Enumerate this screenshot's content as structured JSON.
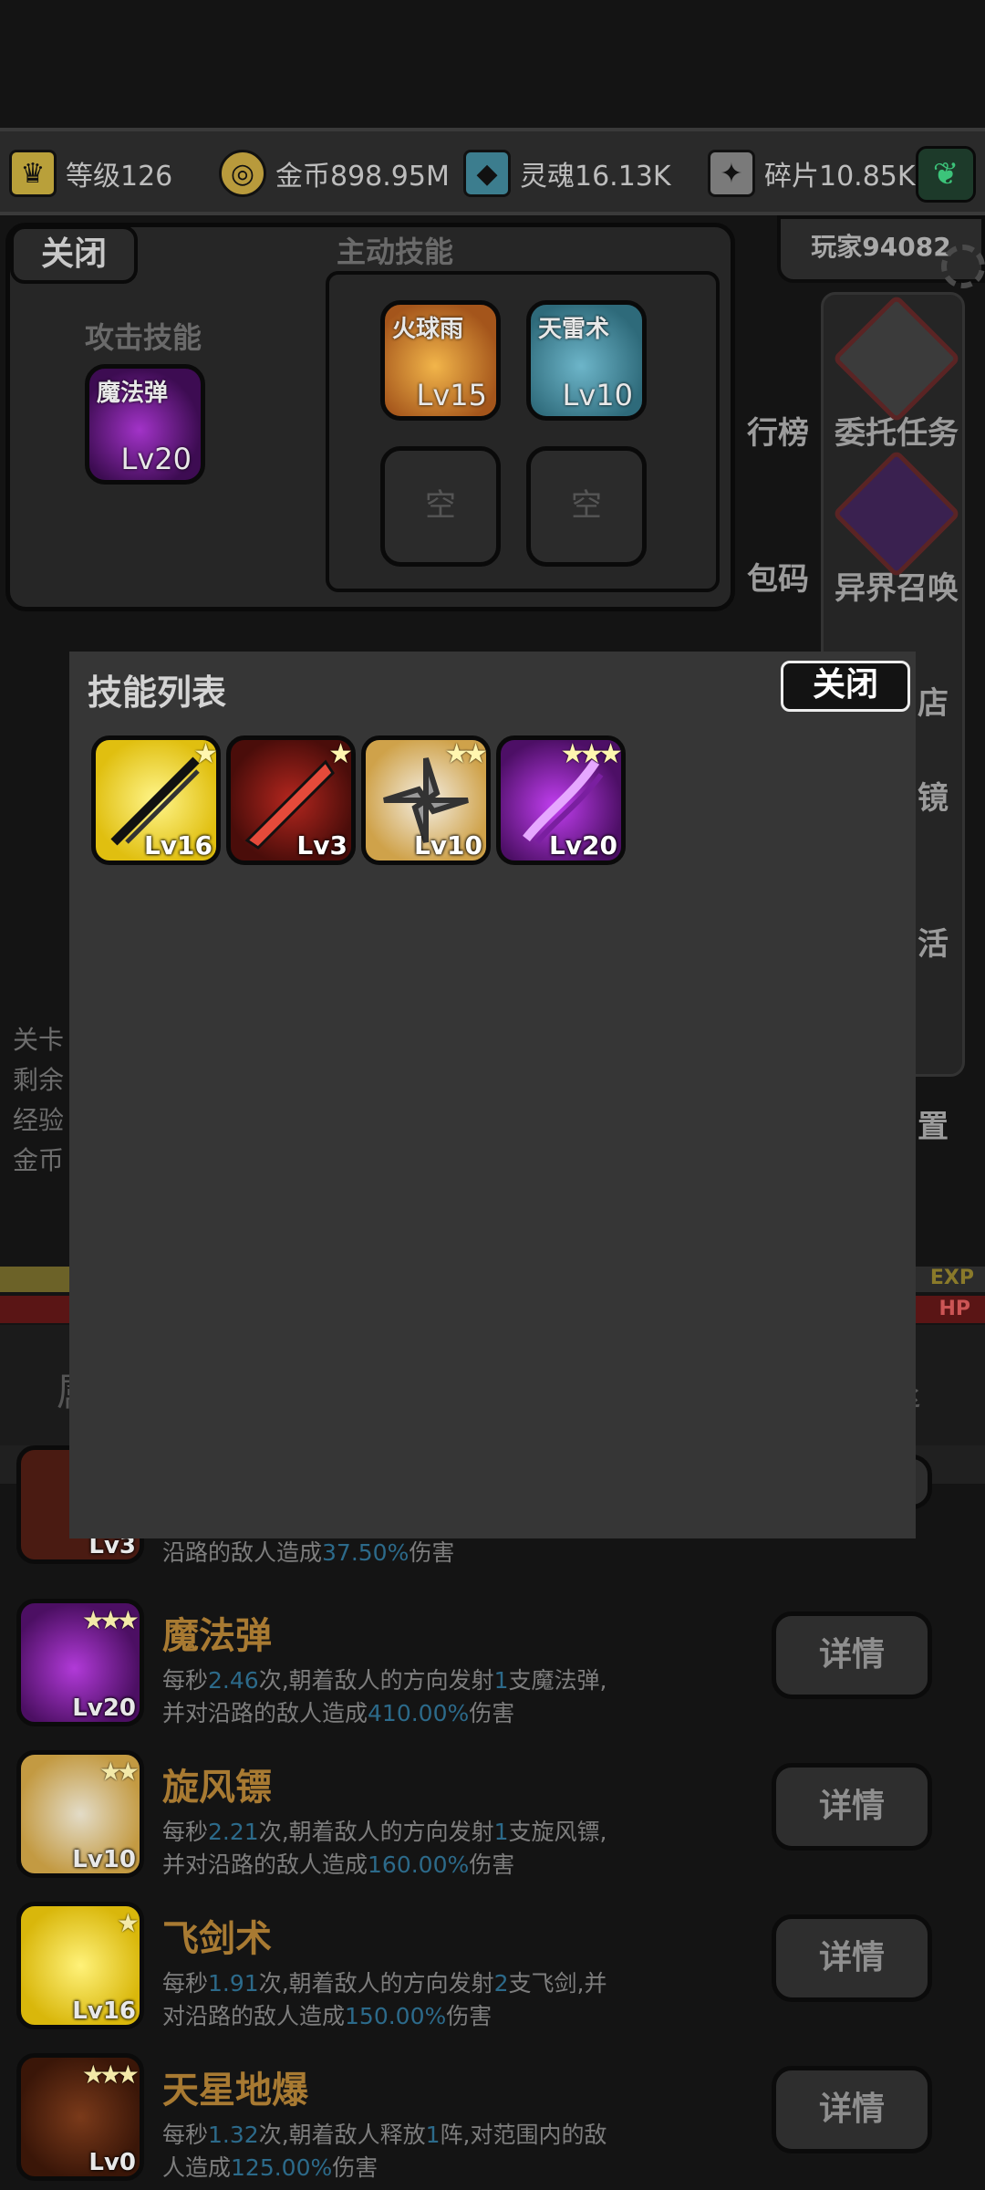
{
  "resources": {
    "level": {
      "label": "等级126",
      "icon": "crown-icon"
    },
    "gold": {
      "label": "金币898.95M",
      "icon": "coin-icon"
    },
    "soul": {
      "label": "灵魂16.13K",
      "icon": "soul-drop-icon"
    },
    "fragment": {
      "label": "碎片10.85K",
      "icon": "shard-icon"
    },
    "leaf_icon": "leaf-icon"
  },
  "player": {
    "name": "玩家94082"
  },
  "side_menu": [
    {
      "label": "行榜"
    },
    {
      "label": "委托任务"
    },
    {
      "label": "包码"
    },
    {
      "label": "异界召唤"
    },
    {
      "label": "店"
    },
    {
      "label": "镜"
    },
    {
      "label": "活"
    },
    {
      "label": "置"
    }
  ],
  "left_stats": [
    "关卡",
    "剩余",
    "经验",
    "金币"
  ],
  "bars": {
    "exp_text": "EXP",
    "hp_text": "HP",
    "exp_fraction": 0.07
  },
  "tabs": {
    "left": "属",
    "right": "退"
  },
  "equip_panel": {
    "close": "关闭",
    "attack_title": "攻击技能",
    "active_title": "主动技能",
    "attack_skill": {
      "name": "魔法弹",
      "lv": "Lv20"
    },
    "active_skills": [
      {
        "name": "火球雨",
        "lv": "Lv15"
      },
      {
        "name": "天雷术",
        "lv": "Lv10"
      }
    ],
    "empty_label": "空"
  },
  "modal": {
    "title": "技能列表",
    "close": "关闭",
    "skills": [
      {
        "lv": "Lv16",
        "stars": "★",
        "icon": "flying-sword-icon"
      },
      {
        "lv": "Lv3",
        "stars": "★",
        "icon": "red-arrow-icon"
      },
      {
        "lv": "Lv10",
        "stars": "★★",
        "icon": "whirlwind-dart-icon"
      },
      {
        "lv": "Lv20",
        "stars": "★★★",
        "icon": "magic-bolt-icon"
      }
    ]
  },
  "skill_list": [
    {
      "name": "",
      "lv": "Lv3",
      "stars": "",
      "desc_parts": [
        "沿路的敌人造成",
        "37.50%",
        "伤害"
      ],
      "detail": ""
    },
    {
      "name": "魔法弹",
      "lv": "Lv20",
      "stars": "★★★",
      "desc": {
        "a": "每秒",
        "b": "2.46",
        "c": "次,朝着敌人的方向发射",
        "d": "1",
        "e": "支魔法弹,",
        "f": "并对沿路的敌人造成",
        "g": "410.00%",
        "h": "伤害"
      },
      "detail": "详情"
    },
    {
      "name": "旋风镖",
      "lv": "Lv10",
      "stars": "★★",
      "desc": {
        "a": "每秒",
        "b": "2.21",
        "c": "次,朝着敌人的方向发射",
        "d": "1",
        "e": "支旋风镖,",
        "f": "并对沿路的敌人造成",
        "g": "160.00%",
        "h": "伤害"
      },
      "detail": "详情"
    },
    {
      "name": "飞剑术",
      "lv": "Lv16",
      "stars": "★",
      "desc": {
        "a": "每秒",
        "b": "1.91",
        "c": "次,朝着敌人的方向发射",
        "d": "2",
        "e": "支飞剑,并",
        "f": "对沿路的敌人造成",
        "g": "150.00%",
        "h": "伤害"
      },
      "detail": "详情"
    },
    {
      "name": "天星地爆",
      "lv": "Lv0",
      "stars": "★★★",
      "desc": {
        "a": "每秒",
        "b": "1.32",
        "c": "次,朝着敌人释放",
        "d": "1",
        "e": "阵,对范围内的敌",
        "f": "人造成",
        "g": "125.00%",
        "h": "伤害"
      },
      "detail": "详情"
    }
  ]
}
